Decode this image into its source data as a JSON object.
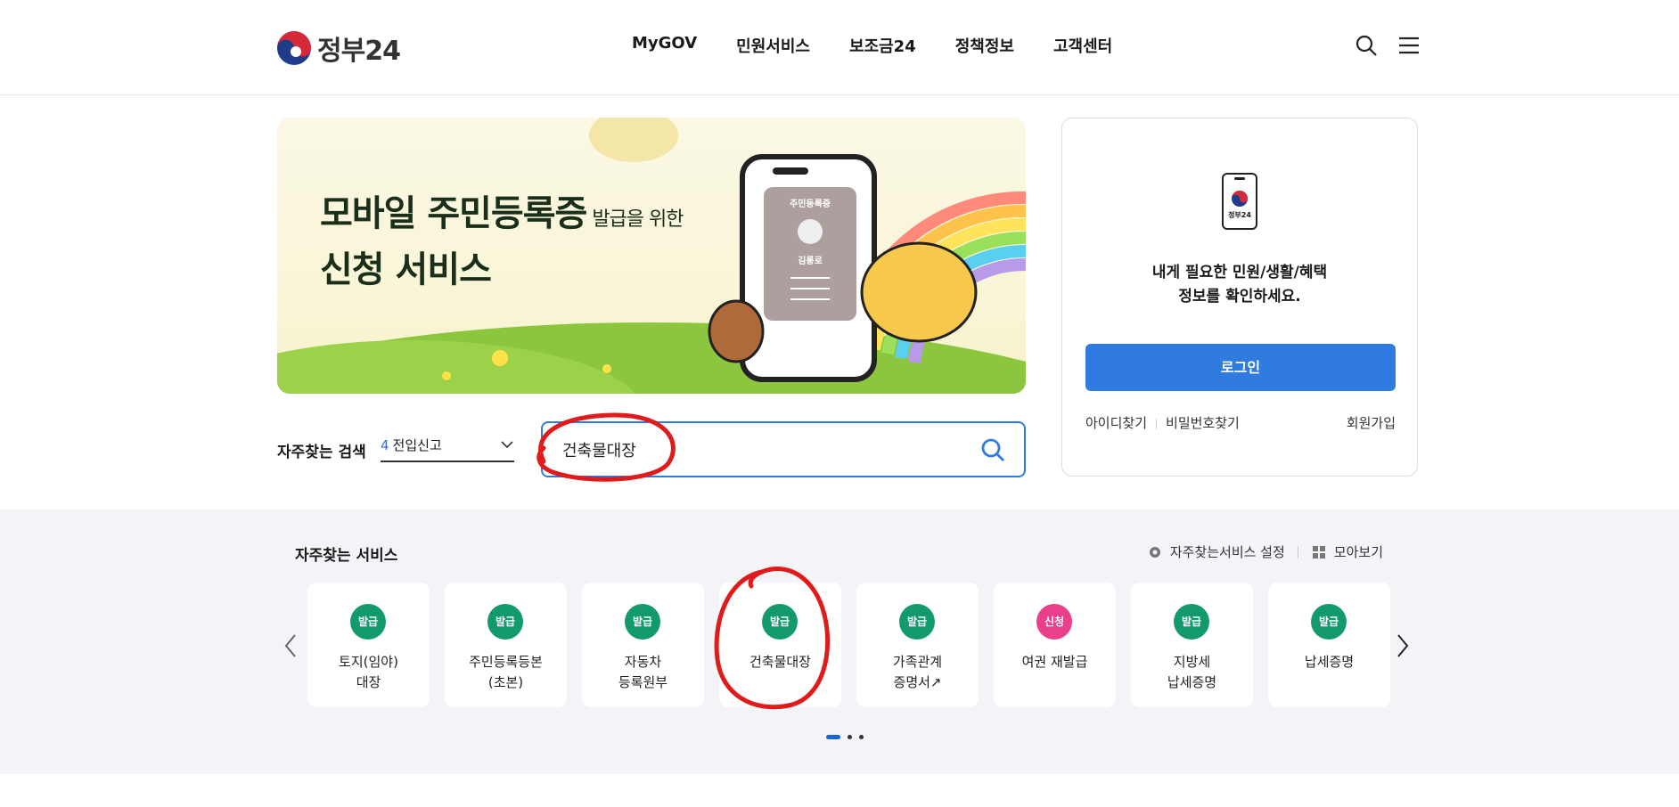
{
  "header": {
    "logo_text": "정부24",
    "nav": [
      "MyGOV",
      "민원서비스",
      "보조금24",
      "정책정보",
      "고객센터"
    ]
  },
  "banner": {
    "title_bold_1": "모바일 주민등록증",
    "title_small": " 발급을 위한",
    "title_bold_2": "신청 서비스",
    "card_title": "주민등록증",
    "card_name": "김롱로"
  },
  "search": {
    "label": "자주찾는 검색",
    "select_num": "4",
    "select_text": "전입신고",
    "query": "건축물대장"
  },
  "login": {
    "phone_label": "정부24",
    "message_line1": "내게 필요한 민원/생활/혜택",
    "message_line2": "정보를 확인하세요.",
    "button": "로그인",
    "find_id": "아이디찾기",
    "find_pw": "비밀번호찾기",
    "join": "회원가입"
  },
  "services": {
    "title": "자주찾는 서비스",
    "settings": "자주찾는서비스 설정",
    "view_all": "모아보기",
    "items": [
      {
        "badge": "발급",
        "label": "토지(임야)\n대장"
      },
      {
        "badge": "발급",
        "label": "주민등록등본\n(초본)"
      },
      {
        "badge": "발급",
        "label": "자동차\n등록원부"
      },
      {
        "badge": "발급",
        "label": "건축물대장"
      },
      {
        "badge": "발급",
        "label": "가족관계\n증명서↗"
      },
      {
        "badge": "신청",
        "label": "여권 재발급"
      },
      {
        "badge": "발급",
        "label": "지방세\n납세증명"
      },
      {
        "badge": "발급",
        "label": "납세증명"
      }
    ]
  },
  "colors": {
    "accent": "#2f7bdf",
    "badge_green": "#129a6a",
    "badge_pink": "#ea3f8a",
    "annotation_red": "#e01b1b"
  }
}
